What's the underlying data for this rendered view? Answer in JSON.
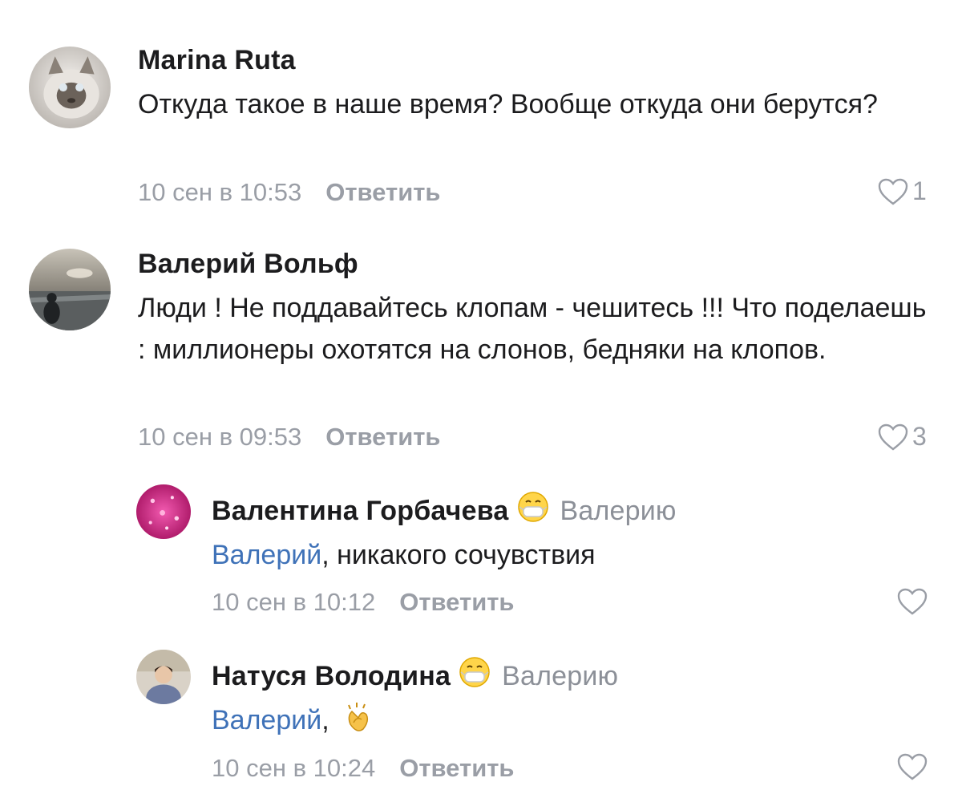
{
  "comments": [
    {
      "author": "Marina Ruta",
      "text": "Откуда такое в наше время? Вообще откуда они берутся?",
      "date": "10 сен в 10:53",
      "reply_label": "Ответить",
      "likes": "1"
    },
    {
      "author": "Валерий Вольф",
      "text": "Люди ! Не поддавайтесь клопам - чешитесь !!! Что поделаешь : миллионеры охотятся на слонов, бедняки на клопов.",
      "date": "10 сен в 09:53",
      "reply_label": "Ответить",
      "likes": "3"
    }
  ],
  "replies": [
    {
      "author": "Валентина Горбачева",
      "author_emoji": "face-with-medical-mask-emoji",
      "reply_to": "Валерию",
      "mention": "Валерий",
      "text": ", никакого сочувствия",
      "date": "10 сен в 10:12",
      "reply_label": "Ответить",
      "likes": ""
    },
    {
      "author": "Натуся Володина",
      "author_emoji": "face-with-medical-mask-emoji",
      "reply_to": "Валерию",
      "mention": "Валерий",
      "text": ",",
      "text_emoji": "clapping-hands-emoji",
      "date": "10 сен в 10:24",
      "reply_label": "Ответить",
      "likes": ""
    }
  ],
  "colors": {
    "text": "#1c1c1e",
    "meta": "#9a9ea6",
    "mention": "#3f72b8",
    "background": "#ffffff"
  },
  "icons": {
    "like": "heart-outline-icon"
  }
}
